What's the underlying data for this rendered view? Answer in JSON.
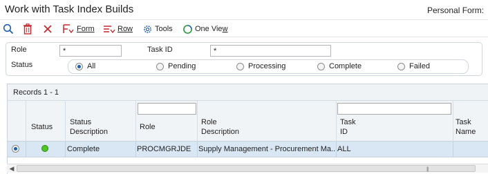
{
  "header": {
    "title": "Work with Task Index Builds",
    "personal_form": "Personal Form:"
  },
  "toolbar": {
    "find_icon": "search-icon",
    "delete_icon": "trash-icon",
    "cancel_icon": "close-icon",
    "form_label": "Form",
    "row_label": "Row",
    "tools_label": "Tools",
    "oneview_label_main": "One Vie",
    "oneview_label_u": "w",
    "icon_color": "#1f5fa8",
    "delete_color": "#c0282d"
  },
  "filters": {
    "role_label": "Role",
    "role_value": "*",
    "task_id_label": "Task ID",
    "task_id_value": "*",
    "status_label": "Status",
    "status_options": [
      "All",
      "Pending",
      "Processing",
      "Complete",
      "Failed"
    ],
    "status_selected": "All"
  },
  "grid": {
    "records_label": "Records 1 - 1",
    "columns": {
      "status": "Status",
      "status_desc_1": "Status",
      "status_desc_2": "Description",
      "role": "Role",
      "role_desc_1": "Role",
      "role_desc_2": "Description",
      "task_id_1": "Task",
      "task_id_2": "ID",
      "task_name_1": "Task",
      "task_name_2": "Name"
    },
    "rows": [
      {
        "status_color": "#4ec626",
        "status_description": "Complete",
        "role": "PROCMGRJDE",
        "role_description": "Supply Management - Procurement Ma...",
        "task_id": "ALL",
        "task_name": ""
      }
    ]
  }
}
